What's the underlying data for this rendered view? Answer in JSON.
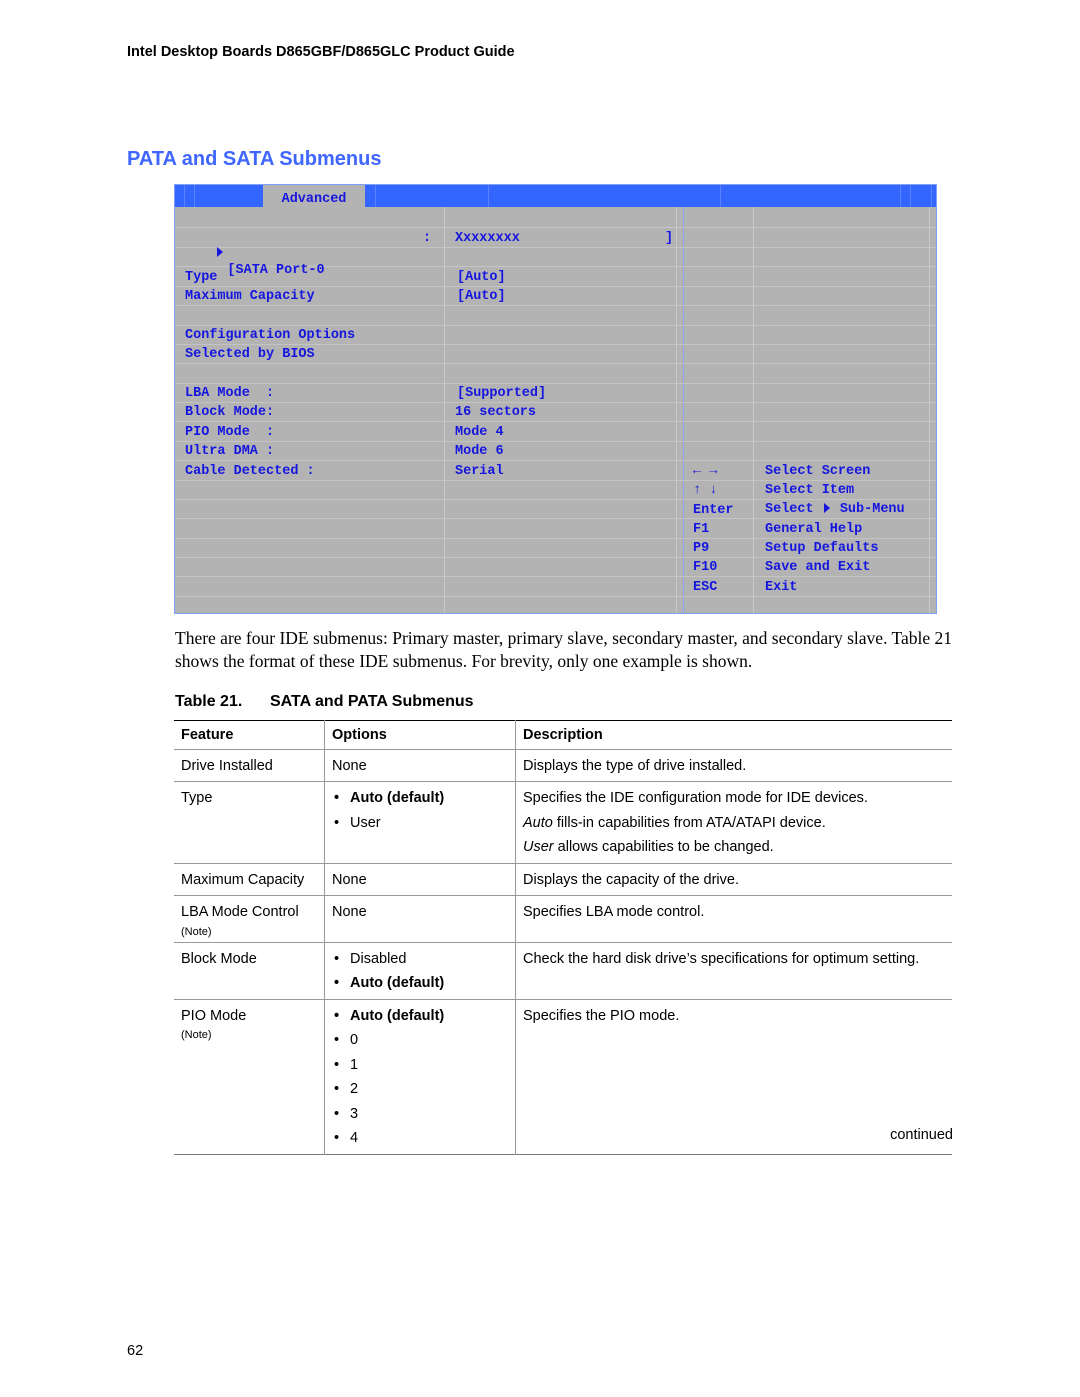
{
  "running_header": "Intel Desktop Boards D865GBF/D865GLC Product Guide",
  "section_title": "PATA and SATA Submenus",
  "bios": {
    "active_tab": "Advanced",
    "port_row": {
      "label": "[SATA Port-0",
      "separator": ":",
      "value": "Xxxxxxxx",
      "close_bracket": "]"
    },
    "settings": [
      {
        "label": "Type",
        "value": "[Auto]"
      },
      {
        "label": "Maximum Capacity",
        "value": "[Auto]"
      }
    ],
    "info_heading": [
      "Configuration Options",
      "Selected by BIOS"
    ],
    "info_rows": [
      {
        "label": "LBA Mode  :",
        "value": "[Supported]"
      },
      {
        "label": "Block Mode:",
        "value": "16 sectors"
      },
      {
        "label": "PIO Mode  :",
        "value": "Mode 4"
      },
      {
        "label": "Ultra DMA :",
        "value": "Mode 6"
      },
      {
        "label": "Cable Detected :",
        "value": "Serial"
      }
    ],
    "help_keys": [
      {
        "key": "← →",
        "action": "Select Screen"
      },
      {
        "key": "↑ ↓",
        "action": "Select Item"
      },
      {
        "key": "Enter",
        "action_pre": "Select ",
        "action_post": " Sub-Menu"
      },
      {
        "key": "F1",
        "action": "General Help"
      },
      {
        "key": "P9",
        "action": "Setup Defaults"
      },
      {
        "key": "F10",
        "action": "Save and Exit"
      },
      {
        "key": "ESC",
        "action": "Exit"
      }
    ],
    "colors": {
      "bar": "#3366ff",
      "panel": "#b3b3b3",
      "text": "#1515e0"
    }
  },
  "paragraph": "There are four IDE submenus:  Primary master, primary slave, secondary master, and secondary slave.  Table 21 shows the format of these IDE submenus.  For brevity, only one example is shown.",
  "table": {
    "caption_number": "Table 21.",
    "caption_title": "SATA and PATA Submenus",
    "headers": [
      "Feature",
      "Options",
      "Description"
    ],
    "rows": [
      {
        "feature": "Drive Installed",
        "note": "",
        "options_text": "None",
        "options": [],
        "description": [
          "Displays the type of drive installed."
        ]
      },
      {
        "feature": "Type",
        "note": "",
        "options": [
          {
            "text": "Auto (default)",
            "bold": true
          },
          {
            "text": "User",
            "bold": false
          }
        ],
        "description_items": [
          {
            "em": "",
            "text": "Specifies the IDE configuration mode for IDE devices."
          },
          {
            "em": "Auto",
            "text": " fills-in capabilities from ATA/ATAPI device."
          },
          {
            "em": "User",
            "text": " allows capabilities to be changed."
          }
        ]
      },
      {
        "feature": "Maximum Capacity",
        "note": "",
        "options_text": "None",
        "description": [
          "Displays the capacity of the drive."
        ]
      },
      {
        "feature": "LBA Mode Control",
        "note": "(Note)",
        "options_text": "None",
        "description": [
          "Specifies LBA mode control."
        ]
      },
      {
        "feature": "Block Mode",
        "note": "",
        "options": [
          {
            "text": "Disabled",
            "bold": false
          },
          {
            "text": "Auto (default)",
            "bold": true
          }
        ],
        "description": [
          "Check the hard disk drive’s specifications for optimum setting."
        ]
      },
      {
        "feature": "PIO Mode",
        "note": "(Note)",
        "options": [
          {
            "text": "Auto (default)",
            "bold": true
          },
          {
            "text": "0",
            "bold": false
          },
          {
            "text": "1",
            "bold": false
          },
          {
            "text": "2",
            "bold": false
          },
          {
            "text": "3",
            "bold": false
          },
          {
            "text": "4",
            "bold": false
          }
        ],
        "description": [
          "Specifies the PIO mode."
        ]
      }
    ],
    "continued_label": "continued"
  },
  "page_number": "62"
}
